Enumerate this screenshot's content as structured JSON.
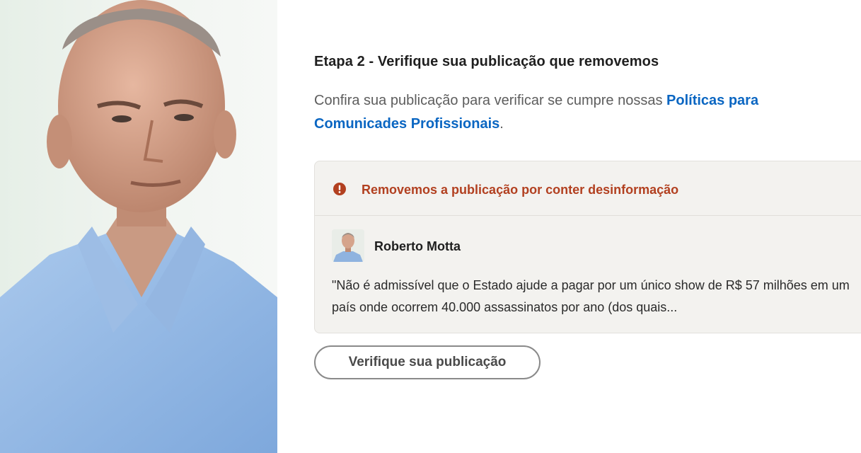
{
  "photo": {
    "alt_subject": "portrait-photo"
  },
  "step": {
    "title": "Etapa 2 - Verifique sua publicação que removemos"
  },
  "description": {
    "text": "Confira sua publicação para verificar se cumpre nossas",
    "link": "Políticas para Comunicades Profissionais",
    "end": "."
  },
  "notice": {
    "icon": "warning-icon",
    "text": "Removemos a publicação por conter desinformação"
  },
  "post": {
    "author": "Roberto Motta",
    "excerpt": "\"Não é admissível que o Estado ajude a pagar por um único show de R$ 57 milhões em um país onde ocorrem 40.000 assassinatos por ano (dos quais..."
  },
  "actions": {
    "verify_label": "Verifique sua publicação"
  },
  "colors": {
    "link": "#0a66c2",
    "warning": "#b24020",
    "card_bg": "#f3f2ef"
  }
}
